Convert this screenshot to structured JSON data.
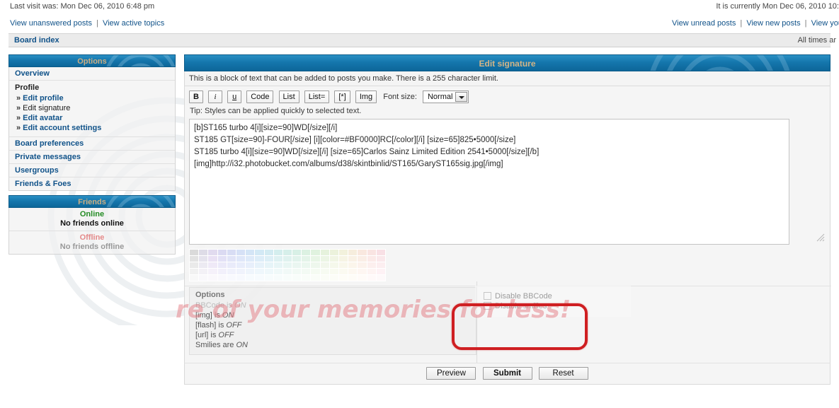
{
  "topbar": {
    "last_visit": "Last visit was: Mon Dec 06, 2010 6:48 pm",
    "current_time": "It is currently Mon Dec 06, 2010 10:"
  },
  "quicklinks": {
    "left": [
      {
        "label": "View unanswered posts"
      },
      {
        "label": "View active topics"
      }
    ],
    "right": [
      {
        "label": "View unread posts"
      },
      {
        "label": "View new posts"
      },
      {
        "label": "View you"
      }
    ],
    "separator": "|"
  },
  "breadcrumb": {
    "board_index": "Board index",
    "timezone": "All times ar"
  },
  "sidebar": {
    "options_title": "Options",
    "overview": "Overview",
    "profile_group": {
      "heading": "Profile",
      "arrow": "»",
      "items": [
        {
          "label": "Edit profile",
          "current": false
        },
        {
          "label": "Edit signature",
          "current": true
        },
        {
          "label": "Edit avatar",
          "current": false
        },
        {
          "label": "Edit account settings",
          "current": false
        }
      ]
    },
    "sections": [
      {
        "label": "Board preferences"
      },
      {
        "label": "Private messages"
      },
      {
        "label": "Usergroups"
      },
      {
        "label": "Friends & Foes"
      }
    ],
    "friends_panel": {
      "title": "Friends",
      "online_label": "Online",
      "online_note": "No friends online",
      "offline_label": "Offline",
      "offline_note": "No friends offline"
    }
  },
  "main": {
    "title": "Edit signature",
    "intro": "This is a block of text that can be added to posts you make. There is a 255 character limit.",
    "toolbar": {
      "buttons": [
        {
          "label": "B",
          "style": "b"
        },
        {
          "label": "i",
          "style": "i"
        },
        {
          "label": "u",
          "style": "u"
        },
        {
          "label": "Code",
          "style": ""
        },
        {
          "label": "List",
          "style": ""
        },
        {
          "label": "List=",
          "style": ""
        },
        {
          "label": "[*]",
          "style": ""
        },
        {
          "label": "Img",
          "style": ""
        }
      ],
      "fontsize_label": "Font size:",
      "fontsize_value": "Normal"
    },
    "tip": "Tip: Styles can be applied quickly to selected text.",
    "signature_text": "[b]ST165 turbo 4[i][size=90]WD[/size][/i]\nST185 GT[size=90]-FOUR[/size] [i][color=#BF0000]RC[/color][/i] [size=65]825•5000[/size]\nST185 turbo 4[i][size=90]WD[/size][/i] [size=65]Carlos Sainz Limited Edition 2541•5000[/size][/b]\n[img]http://i32.photobucket.com/albums/d38/skintbinlid/ST165/GaryST165sig.jpg[/img]",
    "options_box": {
      "title": "Options",
      "lines": [
        {
          "text": "BBCode is ",
          "value": "ON",
          "faint": true
        },
        {
          "text": "[img] is ",
          "value": "ON",
          "faint": false
        },
        {
          "text": "[flash] is ",
          "value": "OFF",
          "faint": false
        },
        {
          "text": "[url] is ",
          "value": "OFF",
          "faint": false
        },
        {
          "text": "Smilies are ",
          "value": "ON",
          "faint": false
        }
      ]
    },
    "checkboxes": [
      {
        "label": "Disable BBCode",
        "checked": false
      },
      {
        "label": "Disable smilies",
        "checked": false
      }
    ],
    "submit_buttons": [
      {
        "label": "Preview",
        "primary": false
      },
      {
        "label": "Submit",
        "primary": true
      },
      {
        "label": "Reset",
        "primary": false
      }
    ]
  },
  "watermark": {
    "text": "re of your memories for less!"
  },
  "annotation": {
    "shape": "red-rounded-rectangle",
    "color": "#cf1f22",
    "targets": "disable-bbcode-and-smilies-checkboxes"
  },
  "theme": {
    "header_blue": "#1577ad",
    "header_text": "#d3b486",
    "link_blue": "#105289",
    "page_bg": "#ffffff",
    "panel_bg": "#f1f1f1"
  },
  "palette_colors": [
    "#9f9f9f",
    "#a8a4bf",
    "#b1a0d4",
    "#a09fdd",
    "#9aa7e2",
    "#93b0e6",
    "#8fbae8",
    "#8cc4e4",
    "#8ccbdc",
    "#8fd1d2",
    "#93d5c7",
    "#99d8bd",
    "#a2dab4",
    "#aedcab",
    "#bddda6",
    "#cddda4",
    "#ddd9a4",
    "#e8cfa6",
    "#eec3ab",
    "#f0b7b2",
    "#edaebb",
    "#b3b3b3",
    "#bcb5cf",
    "#c4b1e1",
    "#b6b0e8",
    "#b1b8eb",
    "#abbfee",
    "#a8c8ef",
    "#a6d0ed",
    "#a6d6e6",
    "#a8dbdd",
    "#acded4",
    "#b1e0cc",
    "#b8e2c4",
    "#c2e4bd",
    "#cee5ba",
    "#dbe5b9",
    "#e6e2b9",
    "#eedbbb",
    "#f2d2be",
    "#f4c9c3",
    "#f2c2ca",
    "#c7c7c7",
    "#cec8dc",
    "#d4c5ea",
    "#cac4ef",
    "#c6caf1",
    "#c2d0f3",
    "#bfd6f4",
    "#bedcf2",
    "#bee1ed",
    "#c0e4e7",
    "#c3e6e0",
    "#c7e8da",
    "#cbe9d4",
    "#d3ebcf",
    "#dcebcd",
    "#e5ecca",
    "#eee9ca",
    "#f3e4cb",
    "#f6ddcd",
    "#f7d6d1",
    "#f6d1d7",
    "#dadada",
    "#dfdbe8",
    "#e4d9f1",
    "#ded8f5",
    "#dbdcf6",
    "#d8e0f7",
    "#d6e5f8",
    "#d5e9f6",
    "#d5ecf3",
    "#d7efee",
    "#d9f0e9",
    "#dcf1e5",
    "#dff2e1",
    "#e4f3de",
    "#eaf3dc",
    "#f0f3da",
    "#f5f1da",
    "#f9eddb",
    "#fbe8dd",
    "#fce2e0",
    "#fbdee4",
    "#ececec",
    "#efedf4",
    "#f2ecf8",
    "#eeecfa",
    "#edeefb",
    "#ebf0fb",
    "#eaf3fc",
    "#e9f5fb",
    "#e9f7f9",
    "#eaf8f6",
    "#ecf9f4",
    "#edf9f1",
    "#eff9ee",
    "#f2faed",
    "#f5faeb",
    "#f8faea",
    "#fbf9ea",
    "#fdf6eb",
    "#fef3ec",
    "#fef0ee",
    "#fdeef1"
  ]
}
